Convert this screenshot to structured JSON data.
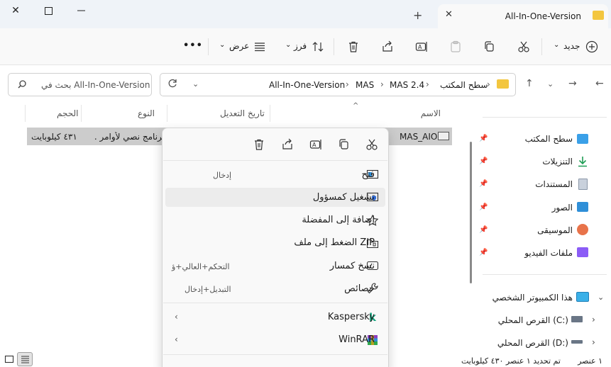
{
  "window": {
    "tab_title": "All-In-One-Version",
    "tab_close_icon": "close-icon",
    "new_tab_icon": "plus-icon"
  },
  "toolbar": {
    "new_label": "جديد",
    "sort_label": "فرز",
    "view_label": "عرض",
    "more_label": "•••"
  },
  "address": {
    "crumbs": [
      "سطح المكتب",
      "MAS 2.4",
      "MAS",
      "All-In-One-Version"
    ],
    "separator": "›"
  },
  "search": {
    "placeholder": "بحث في All-In-One-Version"
  },
  "columns": {
    "name": "الاسم",
    "modified": "تاريخ التعديل",
    "type": "النوع",
    "size": "الحجم"
  },
  "files": [
    {
      "name": "MAS_AIO",
      "type": "برنامج نصي لأوامر ...",
      "size": "٤٣١ كيلوبايت",
      "selected": true
    }
  ],
  "sidebar": {
    "quick_access": [
      {
        "label": "سطح المكتب",
        "icon": "desktop-icon",
        "color": "#3aa0e8"
      },
      {
        "label": "التنزيلات",
        "icon": "download-icon",
        "color": "#1f9d55"
      },
      {
        "label": "المستندات",
        "icon": "documents-icon",
        "color": "#8a97a8"
      },
      {
        "label": "الصور",
        "icon": "pictures-icon",
        "color": "#2f8fd8"
      },
      {
        "label": "الموسيقى",
        "icon": "music-icon",
        "color": "#e8734a"
      },
      {
        "label": "ملفات الفيديو",
        "icon": "videos-icon",
        "color": "#8b5cf6"
      }
    ],
    "this_pc": "هذا الكمبيوتر الشخصي",
    "drives": [
      {
        "label": "القرص المحلي (C:)"
      },
      {
        "label": "القرص المحلي (D:)"
      }
    ]
  },
  "status": {
    "count": "١ عنصر",
    "selection": "تم تحديد ١ عنصر ٤٣٠ كيلوبايت"
  },
  "context_menu": {
    "items": [
      {
        "label": "فتح",
        "shortcut": "إدخال",
        "icon": "open-icon"
      },
      {
        "label": "تشغيل كمسؤول",
        "shortcut": "",
        "icon": "shield-icon"
      },
      {
        "label": "إضافة إلى المفضلة",
        "shortcut": "",
        "icon": "star-icon"
      },
      {
        "label": "الضغط إلى ملف ZIP",
        "shortcut": "",
        "icon": "zip-icon"
      },
      {
        "label": "نسخ كمسار",
        "shortcut": "التحكم+العالي+ؤ",
        "icon": "copy-path-icon"
      },
      {
        "label": "خصائص",
        "shortcut": "التبديل+إدخال",
        "icon": "wrench-icon"
      },
      {
        "label": "Kaspersky",
        "shortcut": "",
        "icon": "kaspersky-icon"
      },
      {
        "label": "WinRAR",
        "shortcut": "",
        "icon": "winrar-icon"
      }
    ]
  }
}
